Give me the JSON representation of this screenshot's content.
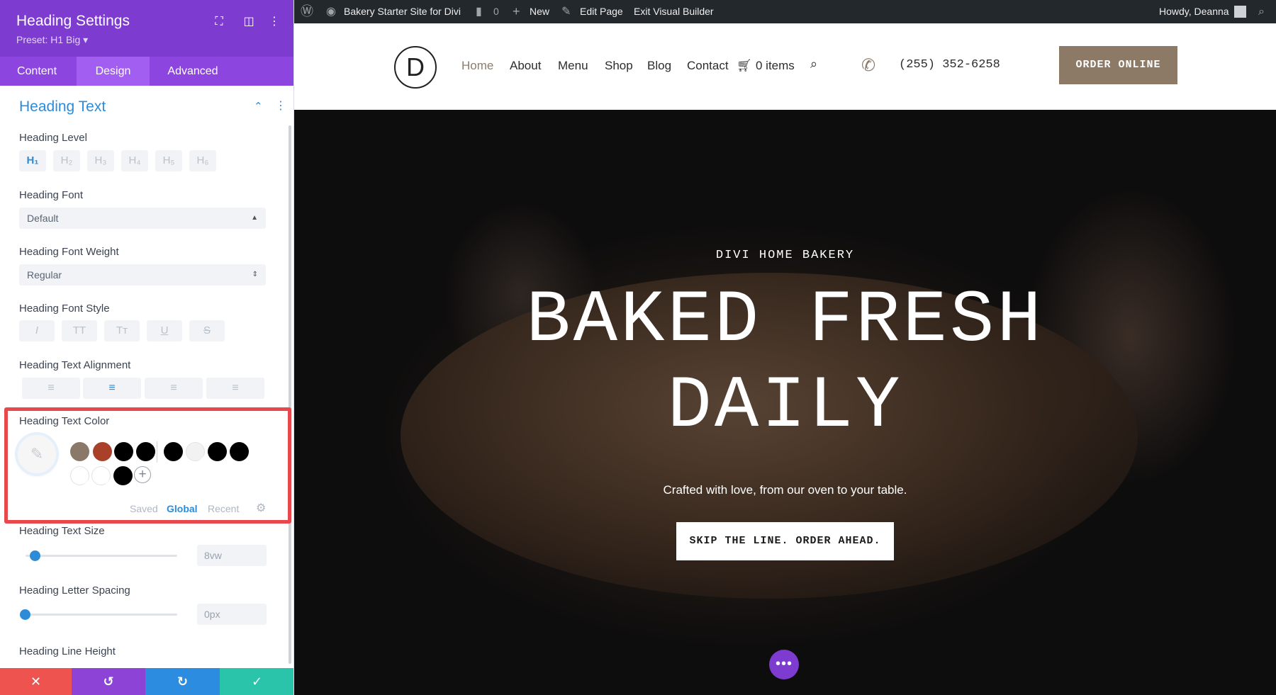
{
  "panel": {
    "title": "Heading Settings",
    "preset": "Preset: H1 Big ▾",
    "tabs": [
      "Content",
      "Design",
      "Advanced"
    ],
    "active_tab": "Design",
    "group_title": "Heading Text",
    "heading_level": {
      "label": "Heading Level",
      "options": [
        "H₁",
        "H₂",
        "H₃",
        "H₄",
        "H₅",
        "H₆"
      ],
      "selected": "H₁"
    },
    "heading_font": {
      "label": "Heading Font",
      "value": "Default"
    },
    "heading_font_weight": {
      "label": "Heading Font Weight",
      "value": "Regular"
    },
    "heading_font_style": {
      "label": "Heading Font Style",
      "options": [
        "I",
        "TT",
        "Tт",
        "U",
        "S"
      ]
    },
    "heading_text_alignment": {
      "label": "Heading Text Alignment",
      "options": [
        "left",
        "center",
        "right",
        "justify"
      ],
      "selected": "center"
    },
    "heading_text_color": {
      "label": "Heading Text Color",
      "swatches_row1": [
        "#8a7868",
        "#a8402a",
        "#000000",
        "#000000",
        "#000000",
        "#f2f2f2",
        "#000000",
        "#000000"
      ],
      "swatches_row2": [
        "#ffffff",
        "#ffffff",
        "#000000"
      ],
      "tabs": [
        "Saved",
        "Global",
        "Recent"
      ],
      "active_tab": "Global"
    },
    "heading_text_size": {
      "label": "Heading Text Size",
      "value": "8vw"
    },
    "heading_letter_spacing": {
      "label": "Heading Letter Spacing",
      "value": "0px"
    },
    "heading_line_height": {
      "label": "Heading Line Height"
    },
    "footer_colors": {
      "discard": "#ef5350",
      "undo": "#8c43d6",
      "redo": "#2c8de0",
      "save": "#29c4a9"
    }
  },
  "adminbar": {
    "site_name": "Bakery Starter Site for Divi",
    "comments_count": "0",
    "new_label": "New",
    "edit_page": "Edit Page",
    "exit_builder": "Exit Visual Builder",
    "howdy": "Howdy, Deanna"
  },
  "site": {
    "logo_letter": "D",
    "nav": [
      "Home",
      "About",
      "Menu",
      "Shop",
      "Blog",
      "Contact"
    ],
    "active_nav": "Home",
    "cart": "0 items",
    "phone": "(255) 352-6258",
    "order_button": "ORDER ONLINE"
  },
  "hero": {
    "eyebrow": "DIVI HOME BAKERY",
    "title_line1": "BAKED FRESH",
    "title_line2": "DAILY",
    "subtitle": "Crafted with love, from our oven to your table.",
    "cta": "SKIP THE LINE. ORDER AHEAD."
  }
}
